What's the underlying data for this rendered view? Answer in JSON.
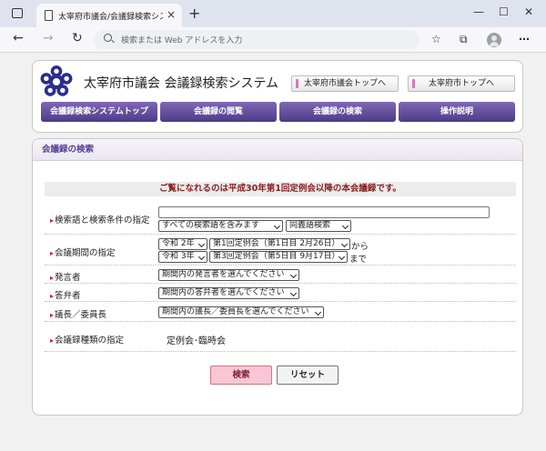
{
  "browser": {
    "tab_title": "太宰府市議会/会議録検索システム",
    "tab_close": "×",
    "new_tab": "+",
    "address_placeholder": "検索または Web アドレスを入力",
    "window_controls": {
      "minimize": "—",
      "maximize": "☐",
      "close": "✕"
    },
    "icons": [
      "back-icon",
      "forward-icon",
      "refresh-icon",
      "search-icon",
      "favorites-icon",
      "collections-icon",
      "profile-icon",
      "more-icon"
    ]
  },
  "header": {
    "site_title": "太宰府市議会 会議録検索システム",
    "links": [
      "太宰府市議会トップへ",
      "太宰府市トップへ"
    ],
    "logo_color": "#2b2d8f"
  },
  "menu": {
    "items": [
      "会議録検索システムトップ",
      "会議録の閲覧",
      "会議録の検索",
      "操作説明"
    ]
  },
  "search": {
    "section_title": "会議録の検索",
    "notice": "ご覧になれるのは平成30年第1回定例会以降の本会議録です。",
    "rows": {
      "keyword": {
        "label": "検索語と検索条件の指定",
        "input_value": "",
        "condition": "すべての検索語を含みます",
        "synonym": "同義語検索"
      },
      "period": {
        "label": "会議期間の指定",
        "from_year": "令和 2年",
        "from_session": "第1回定例会（第1日目 2月26日）",
        "from_suffix": "から",
        "to_year": "令和 3年",
        "to_session": "第3回定例会（第5日目 9月17日）",
        "to_suffix": "まで"
      },
      "speaker": {
        "label": "発言者",
        "select": "期間内の発言者を選んでください"
      },
      "answerer": {
        "label": "答弁者",
        "select": "期間内の答弁者を選んでください"
      },
      "chair": {
        "label": "議長／委員長",
        "select": "期間内の議長／委員長を選んでください"
      },
      "type": {
        "label": "会議録種類の指定",
        "value": "定例会･臨時会"
      }
    },
    "buttons": {
      "search": "検索",
      "reset": "リセット"
    }
  },
  "colors": {
    "accent": "#5b3e96",
    "menu_bg": "#5a4793",
    "notice_text": "#8a1d1d",
    "search_button": "#f9c6d6"
  }
}
